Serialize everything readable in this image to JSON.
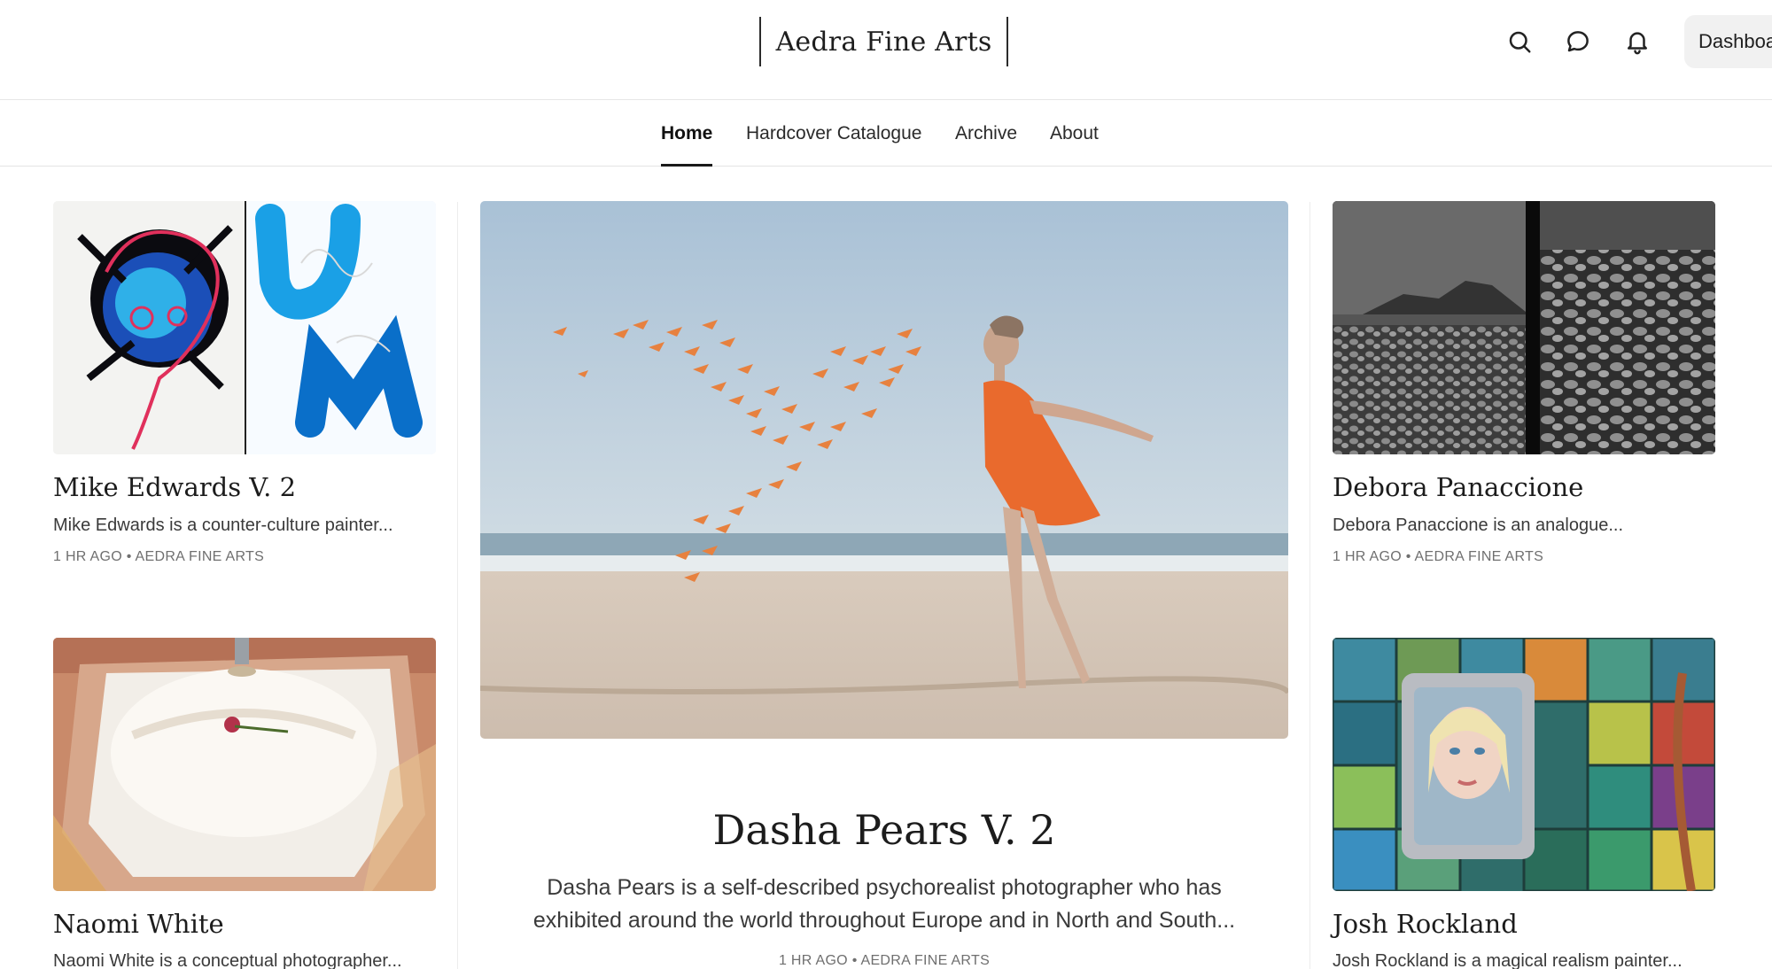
{
  "header": {
    "brand": "Aedra Fine Arts",
    "dashboard_label": "Dashboard",
    "icons": [
      "search-icon",
      "chat-icon",
      "bell-icon"
    ]
  },
  "nav": {
    "items": [
      {
        "label": "Home",
        "active": true
      },
      {
        "label": "Hardcover Catalogue",
        "active": false
      },
      {
        "label": "Archive",
        "active": false
      },
      {
        "label": "About",
        "active": false
      }
    ]
  },
  "posts": {
    "left": [
      {
        "title": "Mike Edwards V. 2",
        "excerpt": "Mike Edwards is a counter-culture painter...",
        "time": "1 HR AGO",
        "author": "AEDRA FINE ARTS"
      },
      {
        "title": "Naomi White",
        "excerpt": "Naomi White is a conceptual photographer..."
      }
    ],
    "featured": {
      "title": "Dasha Pears V. 2",
      "excerpt_line1": "Dasha Pears is a self-described psychorealist photographer who has",
      "excerpt_line2": "exhibited around the world throughout Europe and in North and South...",
      "time": "1 HR AGO",
      "author": "AEDRA FINE ARTS"
    },
    "right": [
      {
        "title": "Debora Panaccione",
        "excerpt": "Debora Panaccione is an analogue...",
        "time": "1 HR AGO",
        "author": "AEDRA FINE ARTS"
      },
      {
        "title": "Josh Rockland",
        "excerpt": "Josh Rockland is a magical realism painter..."
      }
    ]
  },
  "meta_separator": "•",
  "colors": {
    "text": "#1f1f1f",
    "meta": "#6f6f6f",
    "button_bg": "#f1f1f1",
    "divider": "#e6e6e6"
  }
}
